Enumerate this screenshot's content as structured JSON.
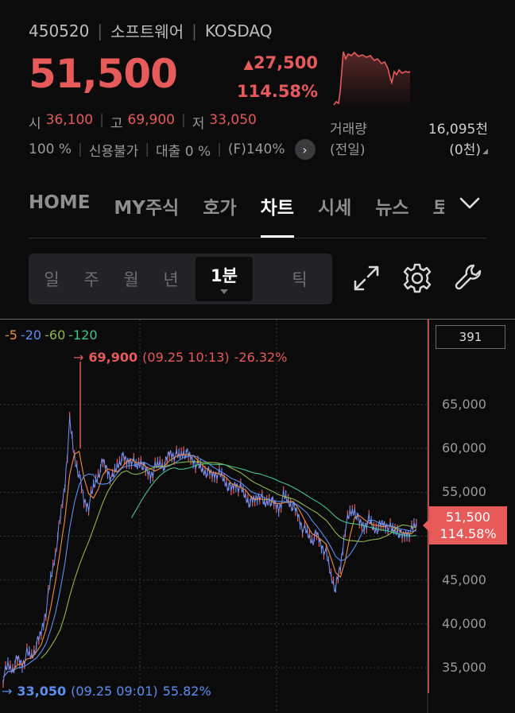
{
  "stock": {
    "code": "450520",
    "name": "소프트웨어",
    "market": "KOSDAQ",
    "price": "51,500",
    "change": "27,500",
    "change_pct": "114.58%",
    "color_up": "#e65a5a"
  },
  "ohl": {
    "open_label": "시",
    "open": "36,100",
    "high_label": "고",
    "high": "69,900",
    "low_label": "저",
    "low": "33,050"
  },
  "misc": {
    "margin": "100 %",
    "credit": "신용불가",
    "loan": "대출 0 %",
    "f_ratio": "(F)140%",
    "more_icon": "chevron-right-icon"
  },
  "volume": {
    "label": "거래량",
    "value": "16,095천",
    "prev_label": "(전일)",
    "prev_value": "(0천)"
  },
  "tabs": [
    {
      "label": "HOME"
    },
    {
      "label": "MY주식"
    },
    {
      "label": "호가"
    },
    {
      "label": "차트",
      "active": true
    },
    {
      "label": "시세"
    },
    {
      "label": "뉴스"
    },
    {
      "label": "토"
    }
  ],
  "period": {
    "items": [
      "일",
      "주",
      "월",
      "년"
    ],
    "selected": "1분",
    "tick": "틱"
  },
  "tools": [
    "expand-icon",
    "settings-icon",
    "wrench-icon"
  ],
  "chart": {
    "legend": {
      "ma5": "5",
      "ma20": "20",
      "ma60": "60",
      "ma120": "120"
    },
    "high_marker": {
      "value": "69,900",
      "time": "(09.25 10:13)",
      "pct": "-26.32%"
    },
    "low_marker": {
      "value": "33,050",
      "time": "(09.25 09:01)",
      "pct": "55.82%"
    },
    "box_value": "391",
    "current": {
      "price": "51,500",
      "pct": "114.58%"
    },
    "y_ticks": [
      "65,000",
      "60,000",
      "55,000",
      "50,000",
      "45,000",
      "40,000",
      "35,000"
    ]
  },
  "chart_data": {
    "type": "line",
    "title": "",
    "ylim": [
      32000,
      68500
    ],
    "y_ticks": [
      35000,
      40000,
      45000,
      50000,
      55000,
      60000,
      65000
    ],
    "series": [
      {
        "name": "5",
        "color": "#f08c3c"
      },
      {
        "name": "20",
        "color": "#5b8ef0"
      },
      {
        "name": "60",
        "color": "#8fb84a"
      },
      {
        "name": "120",
        "color": "#46c48a"
      }
    ],
    "price_path": [
      33900,
      35200,
      34800,
      36000,
      35400,
      36600,
      36300,
      37500,
      39000,
      41500,
      45000,
      48000,
      52000,
      56000,
      63000,
      59000,
      57000,
      54000,
      53500,
      55500,
      57000,
      58500,
      57500,
      56500,
      58000,
      59000,
      58500,
      58800,
      57800,
      58500,
      57500,
      57000,
      57800,
      58300,
      58000,
      59500,
      59300,
      59000,
      59600,
      59200,
      58700,
      58000,
      57500,
      57300,
      57000,
      57200,
      56800,
      56000,
      55300,
      56000,
      55400,
      54500,
      53800,
      54200,
      54800,
      53500,
      54200,
      53700,
      53200,
      54500,
      54000,
      53400,
      52500,
      51000,
      50300,
      49500,
      50200,
      49000,
      48000,
      45500,
      44000,
      46500,
      51000,
      52500,
      53000,
      51500,
      51200,
      51800,
      50800,
      51000,
      51400,
      51200,
      50500,
      50700,
      49900,
      50400,
      50600,
      51500
    ]
  }
}
